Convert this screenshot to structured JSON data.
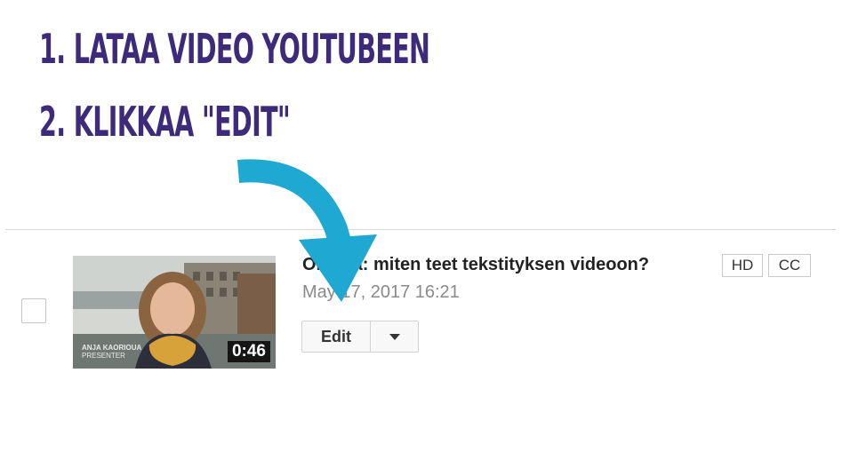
{
  "instructions": {
    "step1": "1. LATAA VIDEO YOUTUBEEN",
    "step2": "2. KLIKKAA \"EDIT\""
  },
  "video": {
    "title": "Ohjeita: miten teet tekstityksen videoon?",
    "badges": [
      "HD",
      "CC"
    ],
    "date": "May 17, 2017 16:21",
    "duration": "0:46",
    "thumbnail_caption_line1": "ANJA KAORIOUA",
    "thumbnail_caption_line2": "PRESENTER",
    "edit_label": "Edit"
  },
  "colors": {
    "heading": "#3d2a7a",
    "arrow": "#1fa9d2"
  },
  "icons": {
    "arrow": "curved-down-arrow-icon",
    "dropdown": "caret-down-icon"
  }
}
